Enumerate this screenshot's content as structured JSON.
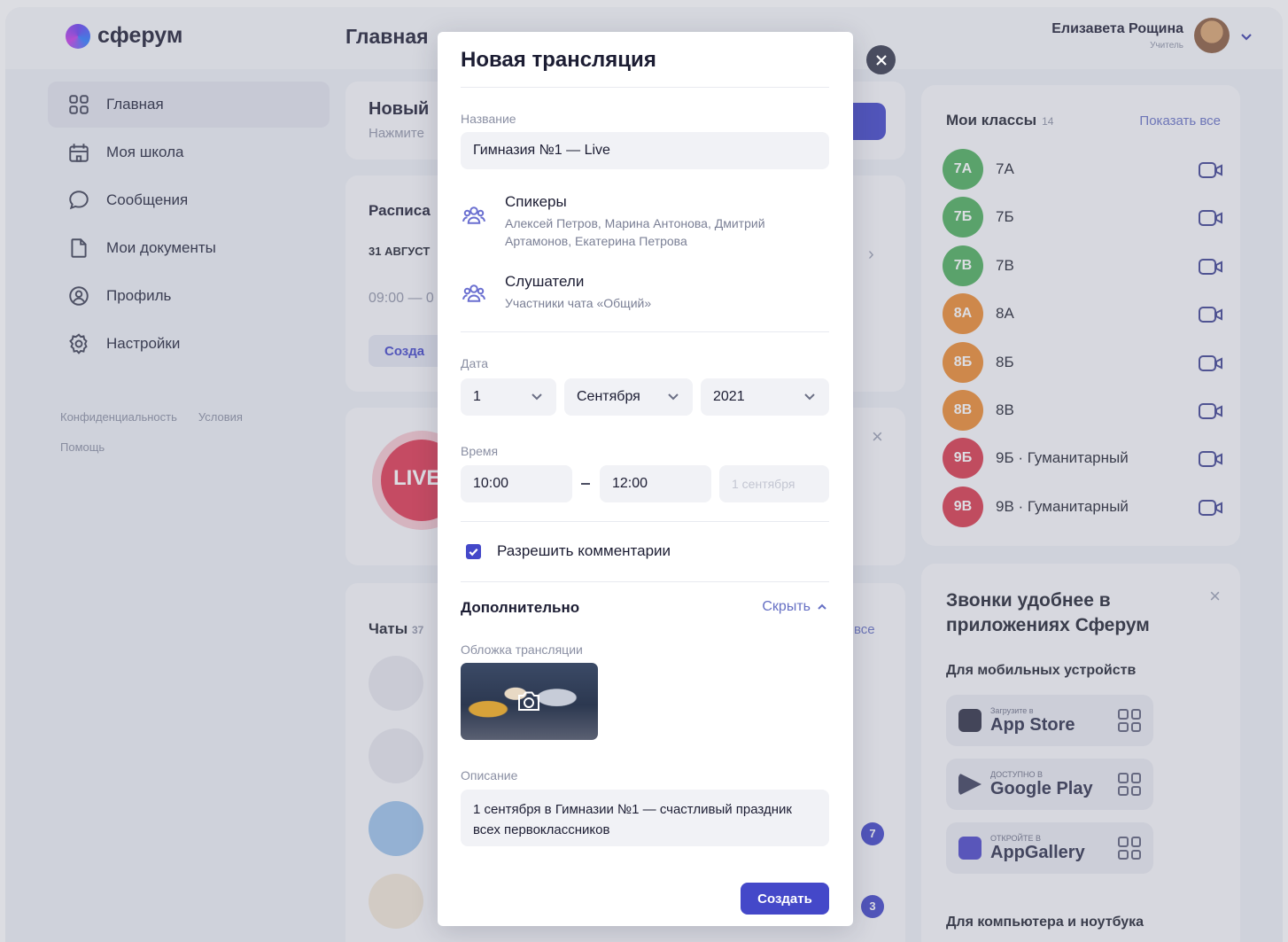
{
  "app": {
    "logo_text": "сферум",
    "page_title": "Главная"
  },
  "user": {
    "name": "Елизавета Рощина",
    "role": "Учитель"
  },
  "sidebar": {
    "items": [
      {
        "label": "Главная",
        "icon": "grid-icon"
      },
      {
        "label": "Моя школа",
        "icon": "school-icon"
      },
      {
        "label": "Сообщения",
        "icon": "chat-bubble-icon"
      },
      {
        "label": "Мои документы",
        "icon": "document-icon"
      },
      {
        "label": "Профиль",
        "icon": "profile-icon"
      },
      {
        "label": "Настройки",
        "icon": "gear-icon"
      }
    ],
    "links": [
      "Конфиденциальность",
      "Условия",
      "Помощь"
    ]
  },
  "background": {
    "new_card_title": "Новый",
    "new_card_sub": "Нажмите",
    "schedule_title": "Расписа",
    "schedule_date": "31 АВГУСТ",
    "schedule_time": "09:00 — 0",
    "schedule_btn": "Созда",
    "live_label": "LIVE",
    "chats_title": "Чаты",
    "chats_count": "37",
    "chats_all": "все",
    "badge_1": "7",
    "badge_2": "3"
  },
  "classes": {
    "title": "Мои классы",
    "count": "14",
    "show_all": "Показать все",
    "items": [
      {
        "badge": "7А",
        "name": "7А",
        "color": "#4cae5b"
      },
      {
        "badge": "7Б",
        "name": "7Б",
        "color": "#4cae5b"
      },
      {
        "badge": "7В",
        "name": "7В",
        "color": "#4cae5b"
      },
      {
        "badge": "8А",
        "name": "8А",
        "color": "#ec8a2f"
      },
      {
        "badge": "8Б",
        "name": "8Б",
        "color": "#ec8a2f"
      },
      {
        "badge": "8В",
        "name": "8В",
        "color": "#ec8a2f"
      },
      {
        "badge": "9Б",
        "name": "9Б · Гуманитарный",
        "color": "#d8374a"
      },
      {
        "badge": "9В",
        "name": "9В · Гуманитарный",
        "color": "#d8374a"
      }
    ]
  },
  "promo": {
    "title": "Звонки удобнее в приложениях Сферум",
    "mobile": "Для мобильных устройств",
    "stores": [
      {
        "small": "Загрузите в",
        "big": "App Store"
      },
      {
        "small": "ДОСТУПНО В",
        "big": "Google Play"
      },
      {
        "small": "ОТКРОЙТЕ В",
        "big": "AppGallery"
      }
    ],
    "desktop": "Для компьютера и ноутбука"
  },
  "modal": {
    "title": "Новая трансляция",
    "name_label": "Название",
    "name_value": "Гимназия №1 — Live",
    "speakers_title": "Спикеры",
    "speakers_value": "Алексей Петров, Марина Антонова, Дмитрий Артамонов, Екатерина Петрова",
    "listeners_title": "Слушатели",
    "listeners_value": "Участники чата «Общий»",
    "date_label": "Дата",
    "day": "1",
    "month": "Сентября",
    "year": "2021",
    "time_label": "Время",
    "time_from": "10:00",
    "time_to": "12:00",
    "end_date": "1 сентября",
    "allow_comments": "Разрешить комментарии",
    "extra_title": "Дополнительно",
    "hide_label": "Скрыть",
    "cover_label": "Обложка трансляции",
    "desc_label": "Описание",
    "desc_value": "1 сентября в Гимназии №1 — счастливый праздник всех первоклассников",
    "create_label": "Создать"
  }
}
